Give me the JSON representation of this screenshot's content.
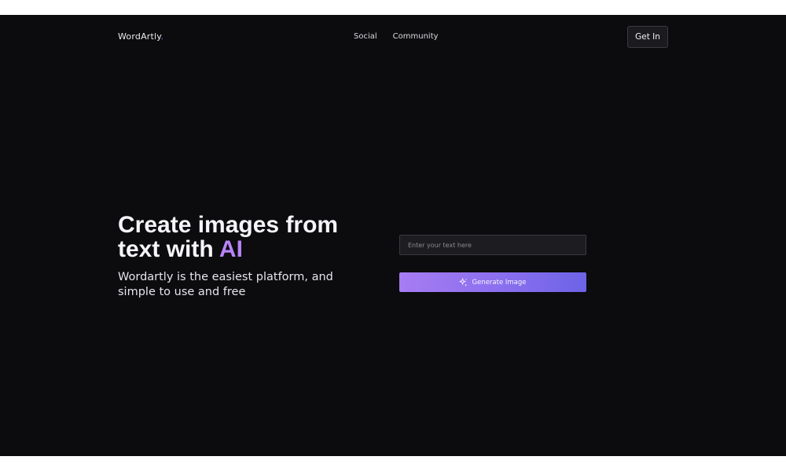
{
  "nav": {
    "brand": "WordArtly",
    "brand_dot": ".",
    "links": [
      {
        "label": "Social"
      },
      {
        "label": "Community"
      }
    ],
    "cta_label": "Get In"
  },
  "hero": {
    "title_line1": "Create images from",
    "title_line2_prefix": "text with",
    "title_accent": "AI",
    "subtitle": "Wordartly is the easiest platform, and simple to use and free"
  },
  "generator": {
    "input_placeholder": "Enter your text here",
    "input_value": "",
    "button_label": "Generate Image",
    "button_icon": "sparkle-icon"
  },
  "colors": {
    "background": "#0c0b0d",
    "accent": "#b884f6",
    "button_gradient_start": "#a77cf2",
    "button_gradient_end": "#6d63e6"
  }
}
